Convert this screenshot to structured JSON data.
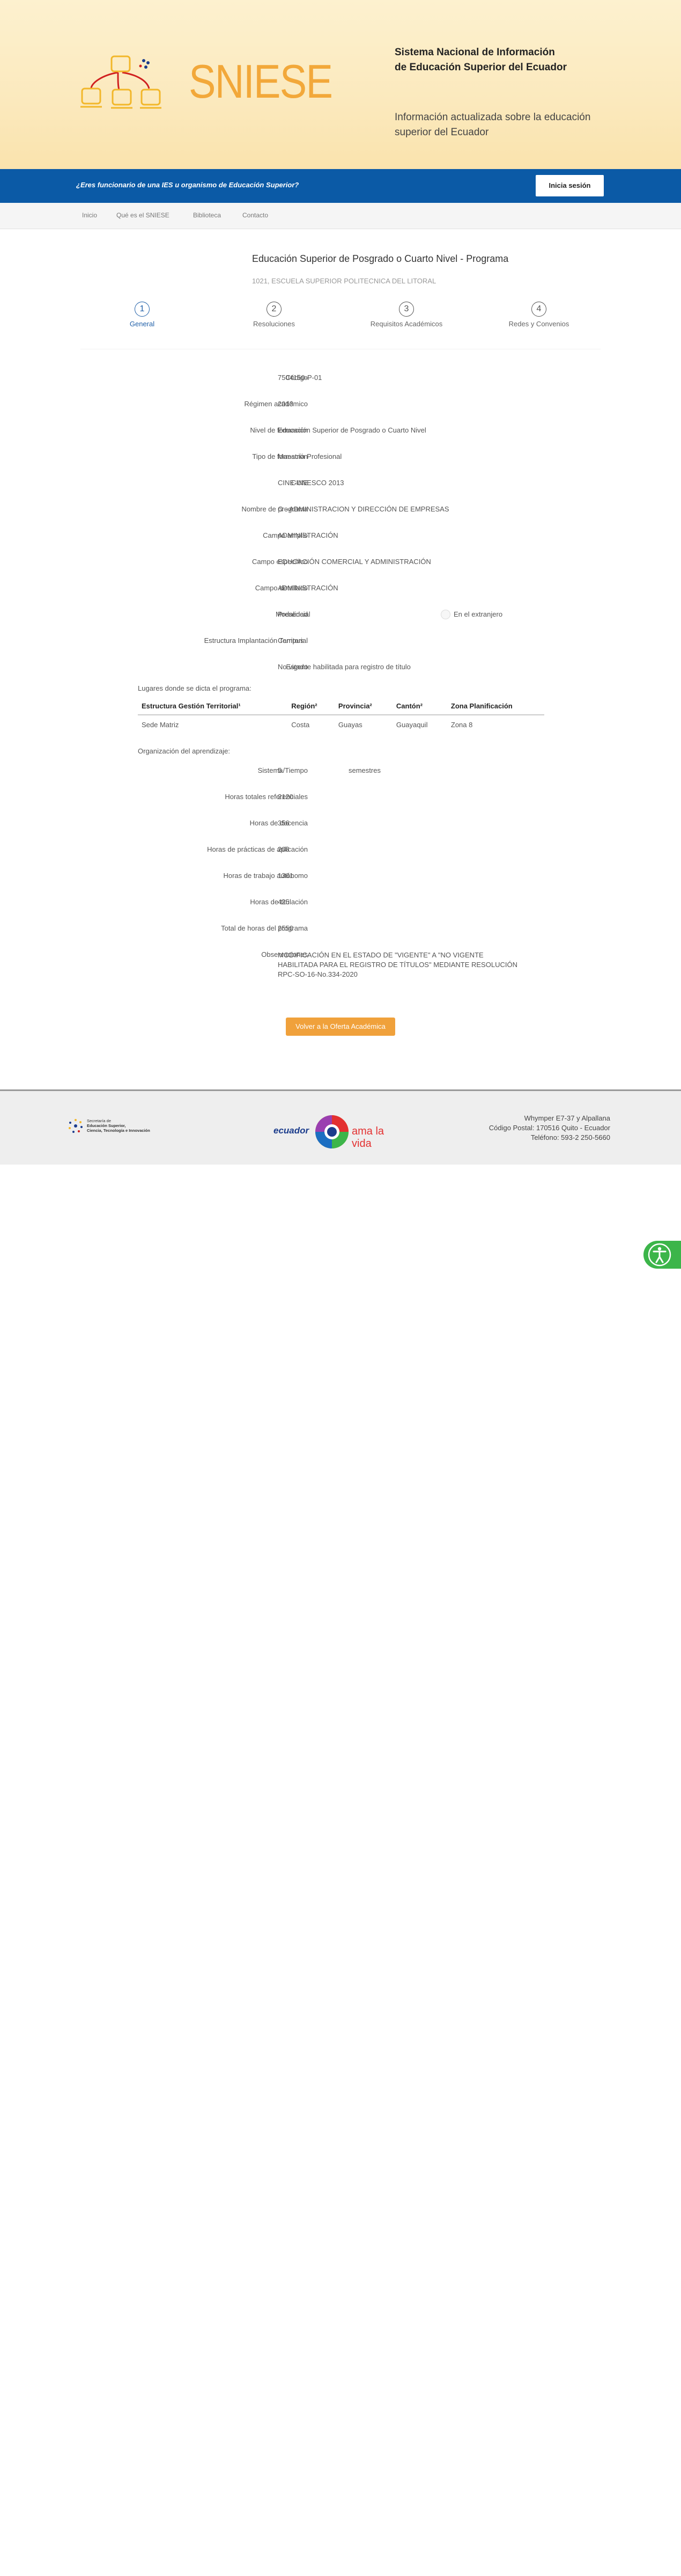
{
  "header": {
    "brand": "SNIESE",
    "title_line1": "Sistema Nacional de Información",
    "title_line2": "de Educación Superior del Ecuador",
    "subtitle_line1": "Información actualizada sobre la educación",
    "subtitle_line2": "superior del Ecuador"
  },
  "bluebar": {
    "question": "¿Eres funcionario de una IES u organismo de Educación Superior?",
    "login_label": "Inicia sesión"
  },
  "nav": {
    "items": [
      "Inicio",
      "Qué es el SNIESE",
      "Biblioteca",
      "Contacto"
    ]
  },
  "program": {
    "title": "Educación Superior de Posgrado o Cuarto Nivel - Programa",
    "institution": "1021, ESCUELA SUPERIOR POLITECNICA DEL LITORAL"
  },
  "steps": [
    {
      "number": "1",
      "label": "General"
    },
    {
      "number": "2",
      "label": "Resoluciones"
    },
    {
      "number": "3",
      "label": "Requisitos Académicos"
    },
    {
      "number": "4",
      "label": "Redes y Convenios"
    }
  ],
  "fields": {
    "codigo": {
      "label": "Código",
      "value": "7504150-P-01"
    },
    "regimen": {
      "label": "Régimen académico",
      "value": "2013"
    },
    "nivel": {
      "label": "Nivel de formación",
      "value": "Educación Superior de Posgrado o Cuarto Nivel"
    },
    "tipo": {
      "label": "Tipo de formación",
      "value": "Maestría Profesional"
    },
    "cine": {
      "label": "CINE",
      "value": "CINE-UNESCO 2013"
    },
    "nombre": {
      "label": "Nombre de programa",
      "value": "O - ADMINISTRACION Y DIRECCIÓN DE EMPRESAS"
    },
    "campo_amplio": {
      "label": "Campo amplio",
      "value": "ADMINISTRACIÓN"
    },
    "campo_especifico": {
      "label": "Campo específico",
      "value": "EDUCACIÓN COMERCIAL Y ADMINISTRACIÓN"
    },
    "campo_detallado": {
      "label": "Campo detallado",
      "value": "ADMINISTRACIÓN"
    },
    "modalidad": {
      "label": "Modalidad",
      "value": "Presencial",
      "checkbox_label": "En el extranjero"
    },
    "estructura": {
      "label": "Estructura Implantación Territorial",
      "value": "Campus"
    },
    "estado": {
      "label": "Estado",
      "value": "No vigente habilitada para registro de título"
    }
  },
  "lugares": {
    "caption": "Lugares donde se dicta el programa:",
    "columns": [
      "Estructura Gestión Territorial¹",
      "Región²",
      "Provincia²",
      "Cantón²",
      "Zona Planificación"
    ],
    "rows": [
      [
        "Sede Matriz",
        "Costa",
        "Guayas",
        "Guayaquil",
        "Zona 8"
      ]
    ]
  },
  "organizacion": {
    "caption": "Organización del aprendizaje:",
    "sistema": {
      "label": "Sistema/Tiempo",
      "value": "5",
      "unit": "semestres"
    },
    "horas_totales": {
      "label": "Horas totales referenciales",
      "value": "2120"
    },
    "horas_docencia": {
      "label": "Horas de docencia",
      "value": "356"
    },
    "horas_practicas": {
      "label": "Horas de prácticas de aplicación",
      "value": "208"
    },
    "horas_autonomo": {
      "label": "Horas de trabajo autónomo",
      "value": "1361"
    },
    "horas_titulacion": {
      "label": "Horas de titulación",
      "value": "425"
    },
    "total_horas": {
      "label": "Total de horas del programa",
      "value": "2550"
    }
  },
  "observaciones": {
    "label": "Observaciones",
    "line1": "MODIFICACIÓN EN EL ESTADO DE \"VIGENTE\" A \"NO VIGENTE",
    "line2": "HABILITADA PARA EL REGISTRO DE TÍTULOS\" MEDIANTE RESOLUCIÓN",
    "line3": "RPC-SO-16-No.334-2020"
  },
  "back_button": "Volver a la Oferta Académica",
  "footer": {
    "senescyt_line1": "Secretaría de",
    "senescyt_line2": "Educación Superior,",
    "senescyt_line3": "Ciencia, Tecnología e Innovación",
    "ecuador_word": "ecuador",
    "ama_word": "ama la vida",
    "address_line1": "Whymper E7-37 y Alpallana",
    "address_line2": "Código Postal: 170516 Quito - Ecuador",
    "address_line3": "Teléfono: 593-2 250-5660"
  },
  "colors": {
    "header_bg": "#fbe9bd",
    "brand_orange": "#f2a83a",
    "blue_bar": "#0b5aa6",
    "active_step": "#1f5fa8",
    "back_button": "#f0a13b",
    "accessibility": "#3cb54a"
  },
  "icons": {
    "logo": "network-computers-logo",
    "accessibility": "accessibility-person-icon"
  }
}
